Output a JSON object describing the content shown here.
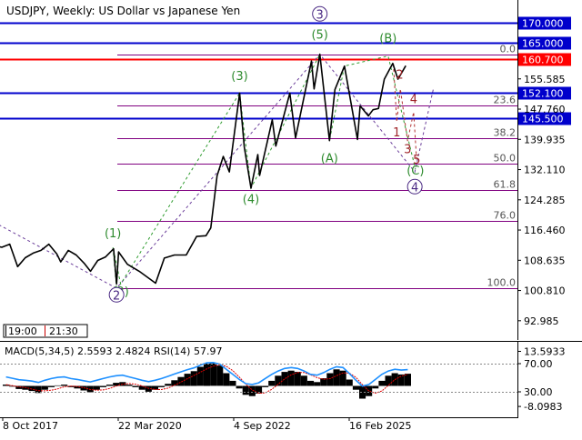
{
  "header": {
    "symbol_line": "USDJPY, Weekly:  US Dollar vs Japanese Yen",
    "time_box_left": "19:00",
    "time_box_right": "21:30"
  },
  "chart_data": {
    "type": "candlestick-line",
    "price_axis": {
      "ylim": [
        88.0,
        176.0
      ],
      "tick_labels": [
        "92.985",
        "100.810",
        "108.635",
        "116.460",
        "124.285",
        "132.110",
        "139.935",
        "147.760",
        "155.585"
      ]
    },
    "x_labels": [
      {
        "date": "2017-10-08",
        "label": "8 Oct 2017"
      },
      {
        "date": "2020-03-22",
        "label": "22 Mar 2020"
      },
      {
        "date": "2022-09-04",
        "label": "4 Sep 2022"
      },
      {
        "date": "2025-02-16",
        "label": "16 Feb 2025"
      }
    ],
    "horizontal_levels": [
      {
        "value": 170.0,
        "label": "170.000",
        "color": "#0000cc"
      },
      {
        "value": 165.0,
        "label": "165.000",
        "color": "#0000cc"
      },
      {
        "value": 160.7,
        "label": "160.700",
        "color": "#ff0000"
      },
      {
        "value": 152.1,
        "label": "152.100",
        "color": "#0000cc"
      },
      {
        "value": 145.5,
        "label": "145.500",
        "color": "#0000cc"
      }
    ],
    "fib_levels": [
      {
        "label": "0.0",
        "value": 161.95
      },
      {
        "label": "23.6",
        "value": 148.6
      },
      {
        "label": "38.2",
        "value": 140.3
      },
      {
        "label": "50.0",
        "value": 133.6
      },
      {
        "label": "61.8",
        "value": 126.9
      },
      {
        "label": "76.0",
        "value": 118.9
      },
      {
        "label": "100.0",
        "value": 101.4
      }
    ],
    "price_series": [
      {
        "date": "2017-08-01",
        "close": 112.5
      },
      {
        "date": "2017-10-01",
        "close": 112.0
      },
      {
        "date": "2017-12-01",
        "close": 112.8
      },
      {
        "date": "2018-02-01",
        "close": 107.0
      },
      {
        "date": "2018-04-01",
        "close": 109.3
      },
      {
        "date": "2018-06-01",
        "close": 110.5
      },
      {
        "date": "2018-08-01",
        "close": 111.2
      },
      {
        "date": "2018-10-01",
        "close": 112.8
      },
      {
        "date": "2018-12-01",
        "close": 110.3
      },
      {
        "date": "2019-01-01",
        "close": 108.2
      },
      {
        "date": "2019-03-01",
        "close": 111.2
      },
      {
        "date": "2019-05-01",
        "close": 110.0
      },
      {
        "date": "2019-07-01",
        "close": 107.9
      },
      {
        "date": "2019-08-20",
        "close": 105.8
      },
      {
        "date": "2019-10-15",
        "close": 108.6
      },
      {
        "date": "2019-12-15",
        "close": 109.5
      },
      {
        "date": "2020-02-15",
        "close": 111.6
      },
      {
        "date": "2020-03-09",
        "close": 102.5
      },
      {
        "date": "2020-03-25",
        "close": 110.8
      },
      {
        "date": "2020-06-01",
        "close": 107.6
      },
      {
        "date": "2020-09-01",
        "close": 105.8
      },
      {
        "date": "2021-01-06",
        "close": 102.7
      },
      {
        "date": "2021-03-15",
        "close": 109.2
      },
      {
        "date": "2021-06-01",
        "close": 110.0
      },
      {
        "date": "2021-09-01",
        "close": 110.0
      },
      {
        "date": "2021-11-20",
        "close": 114.8
      },
      {
        "date": "2022-02-01",
        "close": 115.0
      },
      {
        "date": "2022-03-10",
        "close": 117.0
      },
      {
        "date": "2022-04-28",
        "close": 130.5
      },
      {
        "date": "2022-06-15",
        "close": 135.5
      },
      {
        "date": "2022-08-01",
        "close": 131.5
      },
      {
        "date": "2022-10-20",
        "close": 151.9
      },
      {
        "date": "2022-11-25",
        "close": 138.0
      },
      {
        "date": "2023-01-16",
        "close": 127.3
      },
      {
        "date": "2023-03-10",
        "close": 136.0
      },
      {
        "date": "2023-03-24",
        "close": 130.6
      },
      {
        "date": "2023-06-30",
        "close": 145.0
      },
      {
        "date": "2023-07-28",
        "close": 138.2
      },
      {
        "date": "2023-11-13",
        "close": 151.9
      },
      {
        "date": "2023-12-28",
        "close": 140.3
      },
      {
        "date": "2024-04-29",
        "close": 160.2
      },
      {
        "date": "2024-05-20",
        "close": 153.0
      },
      {
        "date": "2024-07-03",
        "close": 161.95
      },
      {
        "date": "2024-09-16",
        "close": 139.6
      },
      {
        "date": "2024-10-28",
        "close": 152.8
      },
      {
        "date": "2025-01-10",
        "close": 158.9
      },
      {
        "date": "2025-04-21",
        "close": 139.9
      },
      {
        "date": "2025-05-12",
        "close": 148.6
      },
      {
        "date": "2025-07-15",
        "close": 146.0
      },
      {
        "date": "2025-08-20",
        "close": 147.6
      },
      {
        "date": "2025-10-01",
        "close": 147.9
      },
      {
        "date": "2025-11-15",
        "close": 155.5
      },
      {
        "date": "2026-01-20",
        "close": 159.6
      },
      {
        "date": "2026-03-01",
        "close": 155.5
      },
      {
        "date": "2026-05-01",
        "close": 159.0
      }
    ],
    "wave_labels": [
      {
        "text": "(1)",
        "date": "2020-02-10",
        "value": 115.5,
        "color": "#2e8b2e"
      },
      {
        "text": "(2)",
        "date": "2020-04-10",
        "value": 100.5,
        "color": "#2e8b2e"
      },
      {
        "text": "(3)",
        "date": "2022-10-20",
        "value": 156.2,
        "color": "#2e8b2e"
      },
      {
        "text": "(4)",
        "date": "2023-01-16",
        "value": 124.4,
        "color": "#2e8b2e"
      },
      {
        "text": "(5)",
        "date": "2024-07-03",
        "value": 167.0,
        "color": "#2e8b2e"
      },
      {
        "text": "(A)",
        "date": "2024-09-16",
        "value": 135.0,
        "color": "#2e8b2e"
      },
      {
        "text": "(B)",
        "date": "2025-12-15",
        "value": 166.0,
        "color": "#2e8b2e"
      },
      {
        "text": "(C)",
        "date": "2026-07-15",
        "value": 131.8,
        "color": "#2e8b2e"
      },
      {
        "text": "1",
        "date": "2026-02-20",
        "value": 141.7,
        "color": "#a0252a"
      },
      {
        "text": "2",
        "date": "2026-03-15",
        "value": 156.6,
        "color": "#a0252a"
      },
      {
        "text": "3",
        "date": "2026-05-15",
        "value": 137.3,
        "color": "#a0252a"
      },
      {
        "text": "4",
        "date": "2026-07-01",
        "value": 150.2,
        "color": "#a0252a"
      },
      {
        "text": "5",
        "date": "2026-07-25",
        "value": 134.6,
        "color": "#a0252a"
      }
    ],
    "circled_labels": [
      {
        "text": "2",
        "date": "2020-03-09",
        "value": 99.7
      },
      {
        "text": "3",
        "date": "2024-07-03",
        "value": 172.4
      },
      {
        "text": "4",
        "date": "2026-07-10",
        "value": 127.7
      }
    ],
    "macd": {
      "label": "MACD(5,34,5) 2.5593 2.4824 RSI(14) 57.97",
      "ylim": [
        -12.0,
        17.0
      ],
      "tick_labels": [
        "13.5933",
        "70.00",
        "30.00",
        "-8.0983"
      ],
      "histogram": [
        0.5,
        -0.3,
        -1.2,
        -1.5,
        -2.0,
        -2.8,
        -1.5,
        -0.5,
        0.2,
        0.5,
        -0.5,
        -1.0,
        -1.8,
        -2.5,
        -1.5,
        -0.5,
        0.5,
        1.2,
        1.5,
        0.5,
        -0.5,
        -1.5,
        -2.3,
        -1.5,
        -0.5,
        0.8,
        2.2,
        3.5,
        4.8,
        5.8,
        7.5,
        8.8,
        9.0,
        8.0,
        5.0,
        2.0,
        -1.0,
        -3.5,
        -4.0,
        -3.0,
        -0.5,
        2.0,
        4.0,
        5.5,
        6.0,
        5.5,
        4.0,
        2.0,
        1.5,
        3.0,
        5.0,
        6.5,
        6.0,
        2.5,
        -1.5,
        -5.0,
        -4.0,
        -1.0,
        2.0,
        4.0,
        5.0,
        4.5,
        4.8
      ]
    }
  }
}
